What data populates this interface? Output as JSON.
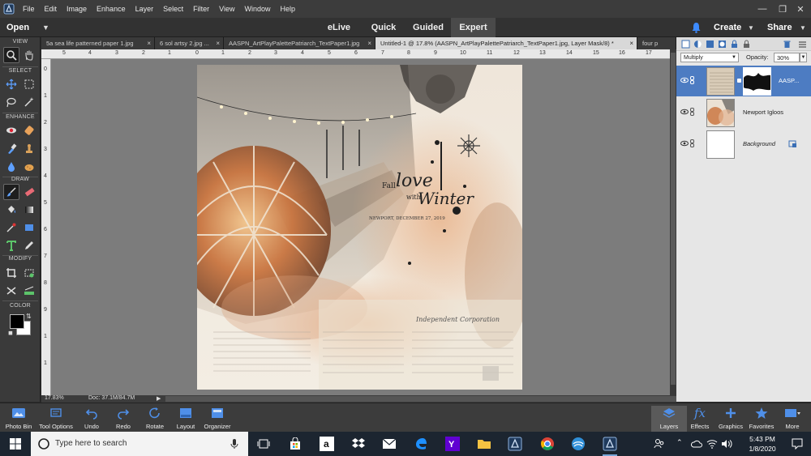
{
  "menu": {
    "items": [
      "File",
      "Edit",
      "Image",
      "Enhance",
      "Layer",
      "Select",
      "Filter",
      "View",
      "Window",
      "Help"
    ]
  },
  "modebar": {
    "open_label": "Open",
    "tabs": [
      "eLive",
      "Quick",
      "Guided",
      "Expert"
    ],
    "active_tab": "Expert",
    "create_label": "Create",
    "share_label": "Share"
  },
  "toolbox": {
    "sections": {
      "view": "VIEW",
      "select": "SELECT",
      "enhance": "ENHANCE",
      "draw": "DRAW",
      "modify": "MODIFY",
      "color": "COLOR"
    },
    "fg_color": "#000000",
    "bg_color": "#ffffff"
  },
  "doc_tabs": [
    {
      "label": "5a sea life patterned paper 1.jpg",
      "active": false
    },
    {
      "label": "6 sol artsy 2.jpg ...",
      "active": false
    },
    {
      "label": "AASPN_ArtPlayPalettePatriarch_TextPaper1.jpg",
      "active": false
    },
    {
      "label": "Untitled-1 @ 17.8% (AASPN_ArtPlayPalettePatriarch_TextPaper1.jpg, Layer Mask/8) *",
      "active": true
    },
    {
      "label": "four p",
      "active": false
    }
  ],
  "ruler": {
    "h_numbers": [
      "5",
      "4",
      "3",
      "2",
      "1",
      "0",
      "1",
      "2",
      "3",
      "4",
      "5",
      "6",
      "7",
      "8",
      "9",
      "10",
      "11",
      "12",
      "13",
      "14",
      "15",
      "16",
      "17"
    ],
    "v_numbers": [
      "0",
      "1",
      "2",
      "3",
      "4",
      "5",
      "6",
      "7",
      "8",
      "9",
      "1",
      "1"
    ]
  },
  "artwork": {
    "title_line1": "Fall",
    "title_line2": "love",
    "title_line3": "with",
    "title_line4": "Winter",
    "date_line": "NEWPORT, DECEMBER 27, 2019",
    "newspaper_head": "Independent Corporation"
  },
  "status": {
    "zoom": "17.83%",
    "doc_size": "Doc: 37.1M/84.7M"
  },
  "layers_panel": {
    "blend_mode": "Multiply",
    "opacity_label": "Opacity:",
    "opacity_value": "30%",
    "layers": [
      {
        "name": "AASP...",
        "selected": true,
        "italic": false
      },
      {
        "name": "Newport Igloos",
        "selected": false,
        "italic": false
      },
      {
        "name": "Background",
        "selected": false,
        "italic": true
      }
    ]
  },
  "bottom_bar": {
    "left": [
      "Photo Bin",
      "Tool Options",
      "Undo",
      "Redo",
      "Rotate",
      "Layout",
      "Organizer"
    ],
    "right": [
      "Layers",
      "Effects",
      "Graphics",
      "Favorites",
      "More"
    ]
  },
  "taskbar": {
    "search_placeholder": "Type here to search",
    "time": "5:43 PM",
    "date": "1/8/2020"
  },
  "colors": {
    "accent_selected": "#4d7cc2",
    "app_dark": "#3c3c3c",
    "taskbar": "#1c2530"
  }
}
